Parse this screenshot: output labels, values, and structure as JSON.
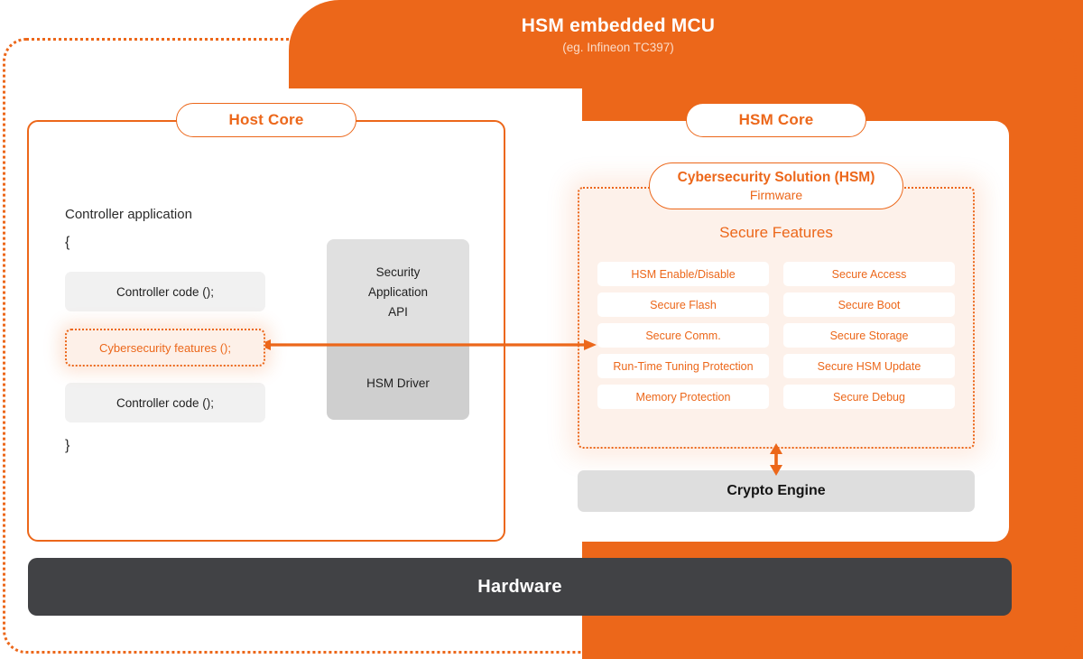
{
  "header": {
    "title": "HSM embedded MCU",
    "subtitle": "(eg. Infineon TC397)"
  },
  "host_core": {
    "pill_label": "Host Core",
    "code_title": "Controller application",
    "brace_open": "{",
    "brace_close": "}",
    "rows": [
      {
        "label": "Controller code ();",
        "highlight": false
      },
      {
        "label": "Cybersecurity features ();",
        "highlight": true
      },
      {
        "label": "Controller code ();",
        "highlight": false
      }
    ],
    "api_block": {
      "top_line1": "Security",
      "top_line2": "Application",
      "top_line3": "API",
      "bottom": "HSM Driver"
    }
  },
  "hsm_core": {
    "pill_label": "HSM Core",
    "solution_pill": {
      "title": "Cybersecurity Solution (HSM)",
      "subtitle": "Firmware"
    },
    "features_title": "Secure Features",
    "features": [
      "HSM Enable/Disable",
      "Secure Access",
      "Secure Flash",
      "Secure Boot",
      "Secure Comm.",
      "Secure Storage",
      "Run-Time Tuning Protection",
      "Secure HSM Update",
      "Memory Protection",
      "Secure Debug"
    ],
    "crypto_engine": "Crypto Engine"
  },
  "hardware": {
    "label": "Hardware"
  },
  "icons": {
    "host_to_hsm_arrow": "double-headed-horizontal-arrow-icon",
    "features_to_crypto_arrow": "double-headed-vertical-arrow-icon"
  },
  "colors": {
    "brand_orange": "#ec671a",
    "panel_tint": "#fdf1ea",
    "code_row_gray": "#f1f1f1",
    "api_top_gray": "#e0e0e0",
    "api_bottom_gray": "#cfcfcf",
    "crypto_gray": "#dedede",
    "hardware_dark": "#414245"
  }
}
